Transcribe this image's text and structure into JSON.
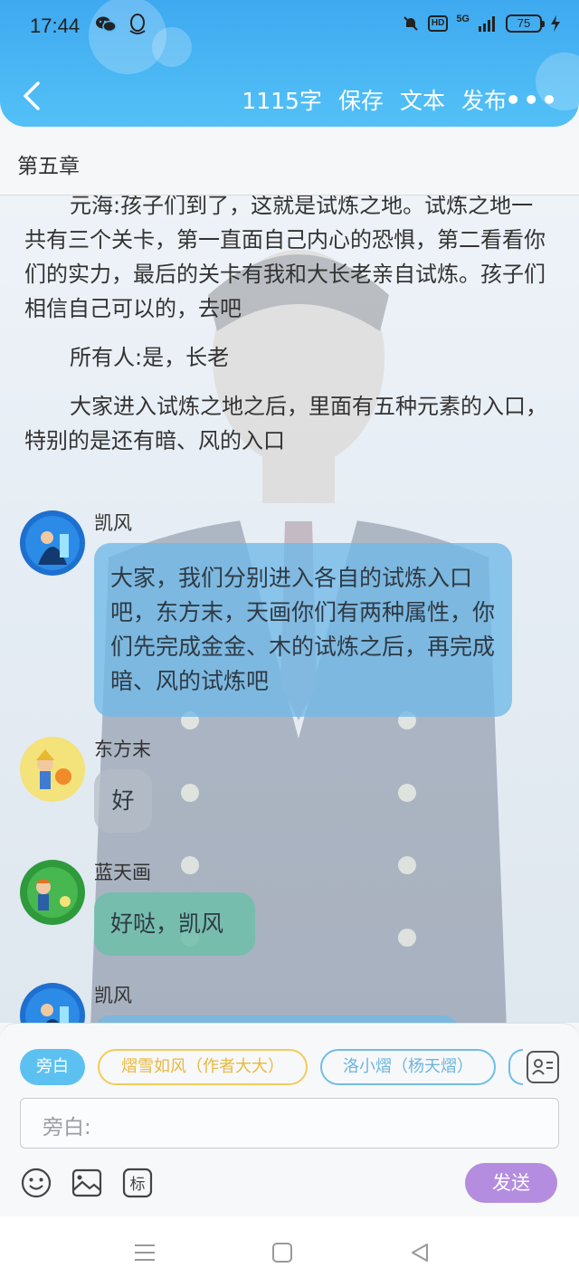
{
  "status_bar": {
    "time": "17:44",
    "network": "5G",
    "hd": "HD",
    "battery": "75"
  },
  "header": {
    "word_count": "1115字",
    "save": "保存",
    "text": "文本",
    "publish": "发布",
    "more": "•••",
    "bg_color": "#3ea9f0"
  },
  "chapter": {
    "title": "第五章"
  },
  "narration": {
    "p1": "元海:孩子们到了，这就是试炼之地。试炼之地一共有三个关卡，第一直面自己内心的恐惧，第二看看你们的实力，最后的关卡有我和大长老亲自试炼。孩子们相信自己可以的，去吧",
    "p2": "所有人:是，长老",
    "p3": "大家进入试炼之地之后，里面有五种元素的入口，特别的是还有暗、风的入口"
  },
  "messages": [
    {
      "name": "凯风",
      "text": "大家，我们分别进入各自的试炼入口吧，东方末，天画你们有两种属性，你们先完成金金、木的试炼之后，再完成暗、风的试炼吧",
      "color": "blue"
    },
    {
      "name": "东方末",
      "text": "好",
      "color": "gray"
    },
    {
      "name": "蓝天画",
      "text": "好哒，凯风",
      "color": "green"
    },
    {
      "name": "凯风",
      "text": "",
      "color": "blue"
    }
  ],
  "panel": {
    "roles": [
      "旁白",
      "熠雪如风（作者大大）",
      "洛小熠（杨天熠）"
    ],
    "input_placeholder": "旁白:",
    "send": "发送",
    "accent": "#b48de0"
  }
}
